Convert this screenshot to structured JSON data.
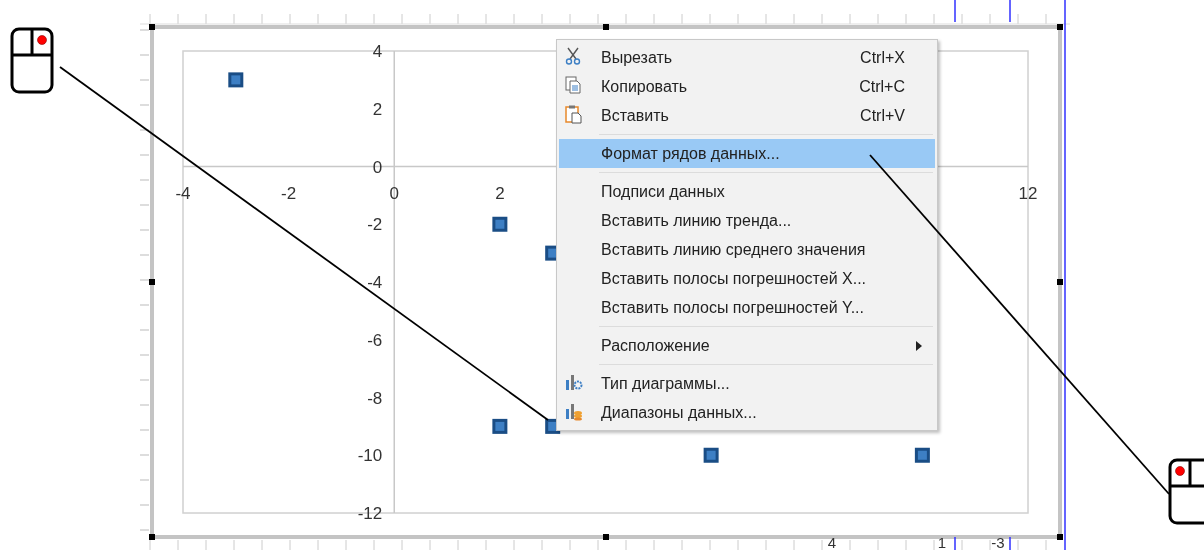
{
  "chart": {
    "chart_data": {
      "type": "scatter",
      "xlim": [
        -4,
        12
      ],
      "ylim": [
        -12,
        4
      ],
      "xticks": [
        -4,
        -2,
        0,
        2,
        12
      ],
      "yticks": [
        4,
        2,
        0,
        -2,
        -4,
        -6,
        -8,
        -10,
        -12
      ],
      "series": [
        {
          "color": "#3d7fc4",
          "x": [
            -3,
            2,
            3,
            2,
            3,
            6,
            10
          ],
          "values": [
            3,
            -2,
            -3,
            -9,
            -9,
            -10,
            -10
          ]
        }
      ]
    },
    "ruler_labels": [
      "4",
      "1",
      "-3"
    ]
  },
  "context_menu": [
    {
      "kind": "item",
      "label": "Вырезать",
      "shortcut": "Ctrl+X",
      "selected": false
    },
    {
      "kind": "item",
      "label": "Копировать",
      "shortcut": "Ctrl+C",
      "selected": false
    },
    {
      "kind": "item",
      "label": "Вставить",
      "shortcut": "Ctrl+V",
      "selected": false
    },
    {
      "kind": "separator"
    },
    {
      "kind": "item",
      "label": "Формат рядов данных...",
      "selected": true
    },
    {
      "kind": "separator"
    },
    {
      "kind": "item",
      "label": "Подписи данных",
      "selected": false
    },
    {
      "kind": "item",
      "label": "Вставить линию тренда...",
      "selected": false
    },
    {
      "kind": "item",
      "label": "Вставить линию среднего значения",
      "selected": false
    },
    {
      "kind": "item",
      "label": "Вставить полосы погрешностей X...",
      "selected": false
    },
    {
      "kind": "item",
      "label": "Вставить полосы погрешностей Y...",
      "selected": false
    },
    {
      "kind": "separator"
    },
    {
      "kind": "item",
      "label": "Расположение",
      "submenu": true,
      "selected": false
    },
    {
      "kind": "separator"
    },
    {
      "kind": "item",
      "label": "Тип диаграммы...",
      "selected": false
    },
    {
      "kind": "item",
      "label": "Диапазоны данных...",
      "selected": false
    }
  ]
}
